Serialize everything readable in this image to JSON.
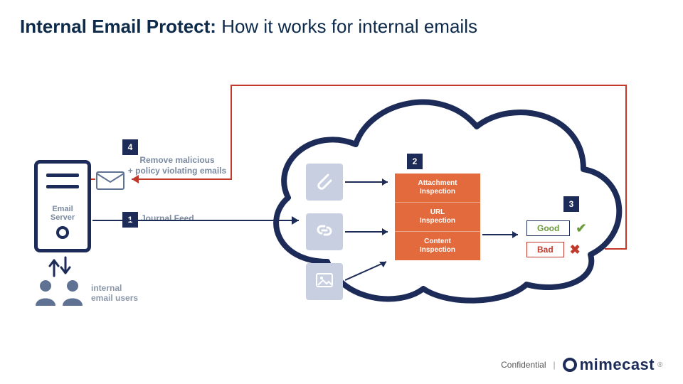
{
  "title": {
    "bold": "Internal Email Protect:",
    "rest": " How it works for internal emails"
  },
  "server": {
    "label_line1": "Email",
    "label_line2": "Server"
  },
  "users_label": "internal\nemail users",
  "steps": {
    "s1": {
      "num": "1",
      "label": "Journal Feed"
    },
    "s2": {
      "num": "2",
      "label": ""
    },
    "s3": {
      "num": "3",
      "label": ""
    },
    "s4": {
      "num": "4",
      "label": "Remove malicious\n+ policy violating emails"
    }
  },
  "inspections": {
    "attachment": "Attachment\nInspection",
    "url": "URL\nInspection",
    "content": "Content\nInspection"
  },
  "result": {
    "good": "Good",
    "bad": "Bad"
  },
  "tiles": {
    "attachment_icon": "paperclip-icon",
    "url_icon": "chain-link-icon",
    "image_icon": "image-icon"
  },
  "footer": {
    "confidential": "Confidential",
    "brand": "mimecast"
  },
  "colors": {
    "navy": "#1c2b57",
    "orange": "#e36a3d",
    "green": "#6a9a3a",
    "red": "#c0392b",
    "gray": "#7a8aa0",
    "tileBg": "#c7cfe0"
  }
}
